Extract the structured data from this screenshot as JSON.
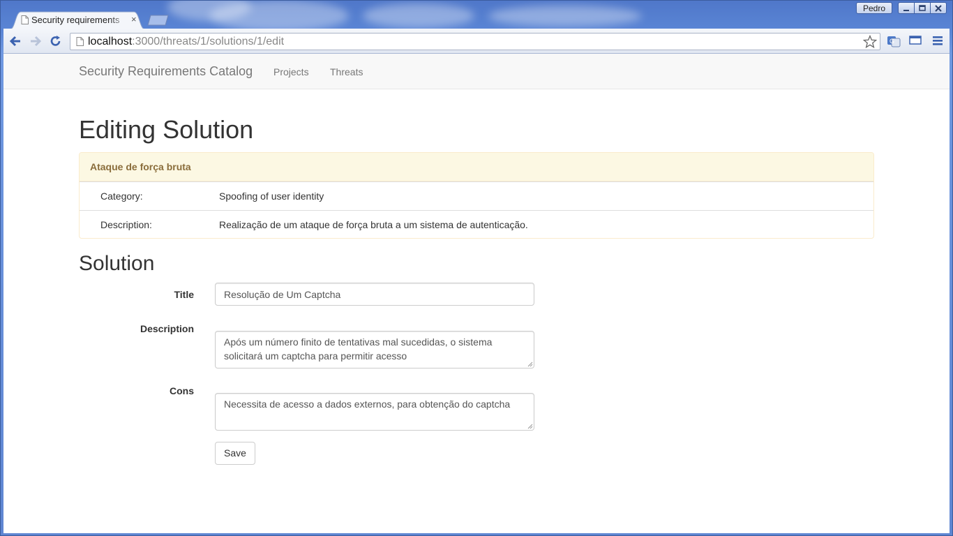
{
  "browser": {
    "profile_name": "Pedro",
    "tab": {
      "title": "Security requirements",
      "close_glyph": "×"
    },
    "address": {
      "host": "localhost",
      "path": ":3000/threats/1/solutions/1/edit"
    },
    "icons": {
      "back": "back-arrow-icon",
      "forward": "forward-arrow-icon",
      "reload": "reload-icon",
      "star": "star-icon",
      "translate": "translate-icon",
      "cast": "window-icon",
      "menu": "hamburger-menu-icon"
    }
  },
  "navbar": {
    "brand": "Security Requirements Catalog",
    "links": [
      "Projects",
      "Threats"
    ]
  },
  "page": {
    "title": "Editing Solution"
  },
  "threat_panel": {
    "heading": "Ataque de força bruta",
    "rows": [
      {
        "label": "Category:",
        "value": "Spoofing of user identity"
      },
      {
        "label": "Description:",
        "value": "Realização de um ataque de força bruta a um sistema de autenticação."
      }
    ]
  },
  "solution_form": {
    "section_title": "Solution",
    "title_label": "Title",
    "title_value": "Resolução de Um Captcha",
    "description_label": "Description",
    "description_value": "Após um número finito de tentativas mal sucedidas, o sistema solicitará um captcha para permitir acesso",
    "cons_label": "Cons",
    "cons_value": "Necessita de acesso a dados externos, para obtenção do captcha",
    "save_label": "Save"
  },
  "colors": {
    "panel_heading_bg": "#fcf8e3",
    "panel_heading_text": "#8a6d3b",
    "panel_border": "#faebcc",
    "navbar_bg": "#f8f8f8",
    "chrome_frame": "#5b86d6"
  }
}
